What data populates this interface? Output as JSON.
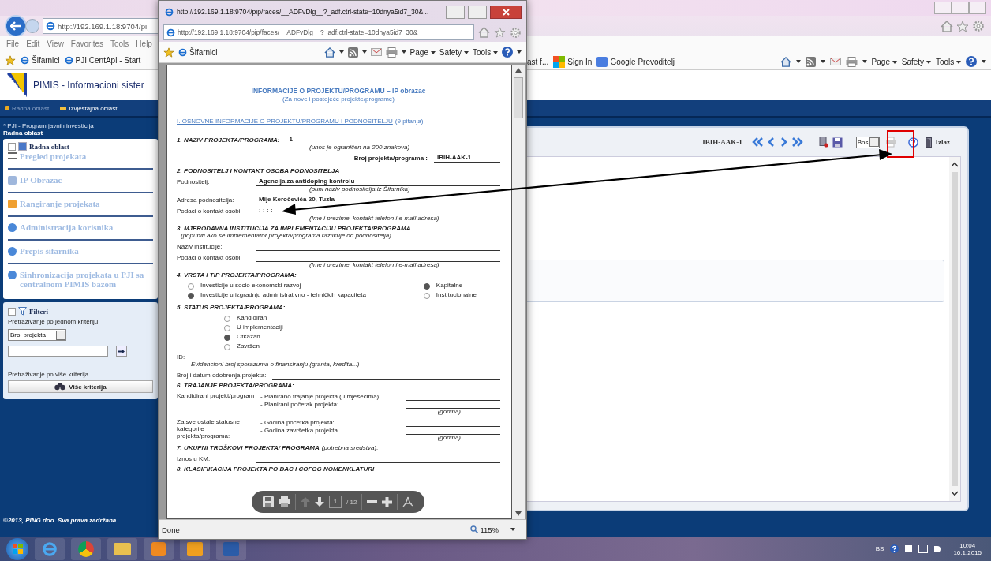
{
  "browser": {
    "address": "http://192.169.1.18:9704/pi",
    "menu": [
      "File",
      "Edit",
      "View",
      "Favorites",
      "Tools",
      "Help"
    ],
    "favorites": [
      "Šifarnici",
      "PJI CentApl - Start"
    ],
    "favorites_right": [
      "ast f...",
      "Sign In",
      "Google Prevoditelj"
    ],
    "commands": [
      "Page",
      "Safety",
      "Tools"
    ]
  },
  "app": {
    "title": "PIMIS - Informacioni sister",
    "nav": [
      {
        "label": "Radna oblast",
        "disabled": true
      },
      {
        "label": "Izvještajna oblast",
        "disabled": false
      }
    ],
    "sidebar": {
      "program": "* PJI - Program javnih investicija",
      "area": "Radna oblast",
      "panel_title": "Radna oblast",
      "items": [
        "Pregled projekata",
        "IP Obrazac",
        "Rangiranje projekata",
        "Administracija korisnika",
        "Prepis šifarnika",
        "Sinhronizacija projekata u PJI sa centralnom PIMIS bazom"
      ]
    },
    "filters": {
      "title": "Filteri",
      "single_label": "Pretraživanje po jednom kriteriju",
      "criterion": "Broj projekta",
      "multi_label": "Pretraživanje po više kriterija",
      "multi_button": "Više kriterija"
    },
    "toolbar": {
      "project": "IBIH-AAK-1",
      "language": "Bos",
      "exit": "Izlaz"
    },
    "footer": "©2013, PING doo. Sva prava zadržana."
  },
  "popup": {
    "title": "http://192.169.1.18:9704/pip/faces/__ADFvDlg__?_adf.ctrl-state=10dnya5id7_30&...",
    "address": "http://192.169.1.18:9704/pip/faces/__ADFvDlg__?_adf.ctrl-state=10dnya5id7_30&_",
    "favorite": "Šifarnici",
    "commands": [
      "Page",
      "Safety",
      "Tools"
    ],
    "status": "Done",
    "zoom": "115%",
    "pdf": {
      "title": "INFORMACIJE O PROJEKTU/PROGRAMU – IP obrazac",
      "subtitle": "(Za nove i postojeće projekte/programe)",
      "section": "I. OSNOVNE INFORMACIJE O PROJEKTU/PROGRAMU I PODNOSITELJU",
      "section_note": "(9 pitanja)",
      "page": "1",
      "pages": "/ 12",
      "blocks": [
        {
          "kind": "heading_field",
          "label": "1. NAZIV PROJEKTA/PROGRAMA:",
          "value": "1",
          "hint": "(unos je ograničen na 200 znakova)"
        },
        {
          "kind": "right_field",
          "label": "Broj projekta/programa :",
          "value": "IBIH-AAK-1"
        },
        {
          "kind": "heading",
          "text": "2. PODNOSITELJ  I KONTAKT OSOBA PODNOSITELJA"
        },
        {
          "kind": "field",
          "label": "Podnositelj:",
          "value": "Agencija za antidoping kontrolu",
          "hint": "(puni naziv podnositelja iz Šifarnika)"
        },
        {
          "kind": "field",
          "label": "Adresa podnositelja:",
          "value": "Mije Keročevića 20, Tuzla"
        },
        {
          "kind": "field",
          "label": "Podaci o kontakt osobi:",
          "value": ": : : :",
          "hint": "(Ime i prezime, kontakt telefon i e-mail adresa)"
        },
        {
          "kind": "heading",
          "text": "3. MJERODAVNA  INSTITUCIJA ZA IMPLEMENTACIJU PROJEKTA/PROGRAMA",
          "subnote": "(popuniti ako se implementator projekta/programa razlikuje od podnositelja)"
        },
        {
          "kind": "field",
          "label": "Naziv institucije:"
        },
        {
          "kind": "field",
          "label": "Podaci o kontakt  osobi:",
          "hint": "(Ime i prezime,  kontakt telefon i e-mail adresa)"
        },
        {
          "kind": "heading",
          "text": "4. VRSTA I TIP PROJEKTA/PROGRAMA:"
        },
        {
          "kind": "radio_columns",
          "columns": [
            [
              {
                "label": "Investicije u socio-ekonomski razvoj",
                "selected": false
              },
              {
                "label": "Investicije u izgradnju administrativno - tehničkih kapaciteta",
                "selected": true
              }
            ],
            [
              {
                "label": "Kapitalne",
                "selected": true
              },
              {
                "label": "Institucionalne",
                "selected": false
              }
            ]
          ]
        },
        {
          "kind": "heading",
          "text": "5. STATUS  PROJEKTA/PROGRAMA:"
        },
        {
          "kind": "radios",
          "options": [
            {
              "label": "Kandidiran",
              "selected": false
            },
            {
              "label": "U implementaciji",
              "selected": false
            },
            {
              "label": "Otkazan",
              "selected": true
            },
            {
              "label": "Završen",
              "selected": false
            }
          ]
        },
        {
          "kind": "short_field",
          "label": "ID:",
          "hint": "Evidencioni broj sporazuma o finansiranju  (granta, kredita...)"
        },
        {
          "kind": "field",
          "label": "Broj i datum odobrenja projekta:"
        },
        {
          "kind": "heading",
          "text": "6. TRAJANJE PROJEKTA/PROGRAMA:"
        },
        {
          "kind": "duration",
          "label": "Kandidirani projekt/program",
          "lines": [
            "-  Planirano trajanje projekta (u mjesecima):",
            "-  Planirani početak projekta:"
          ],
          "hint": "(godina)"
        },
        {
          "kind": "duration",
          "label": "Za sve ostale statusne kategorije projekta/programa:",
          "lines": [
            "-  Godina početka projekta:",
            "-  Godina završetka projekta"
          ],
          "hint": "(godina)"
        },
        {
          "kind": "heading",
          "text": "7. UKUPNI TROŠKOVI PROJEKTA/ PROGRAMA",
          "note": "(potrebna sredstva):"
        },
        {
          "kind": "field",
          "label": "Iznos u KM:"
        },
        {
          "kind": "heading",
          "text": "8. KLASIFIKACIJA PROJEKTA PO DAC I COFOG NOMENKLATURI"
        }
      ]
    }
  },
  "taskbar": {
    "language": "BS",
    "time": "10:04",
    "date": "16.1.2015"
  }
}
